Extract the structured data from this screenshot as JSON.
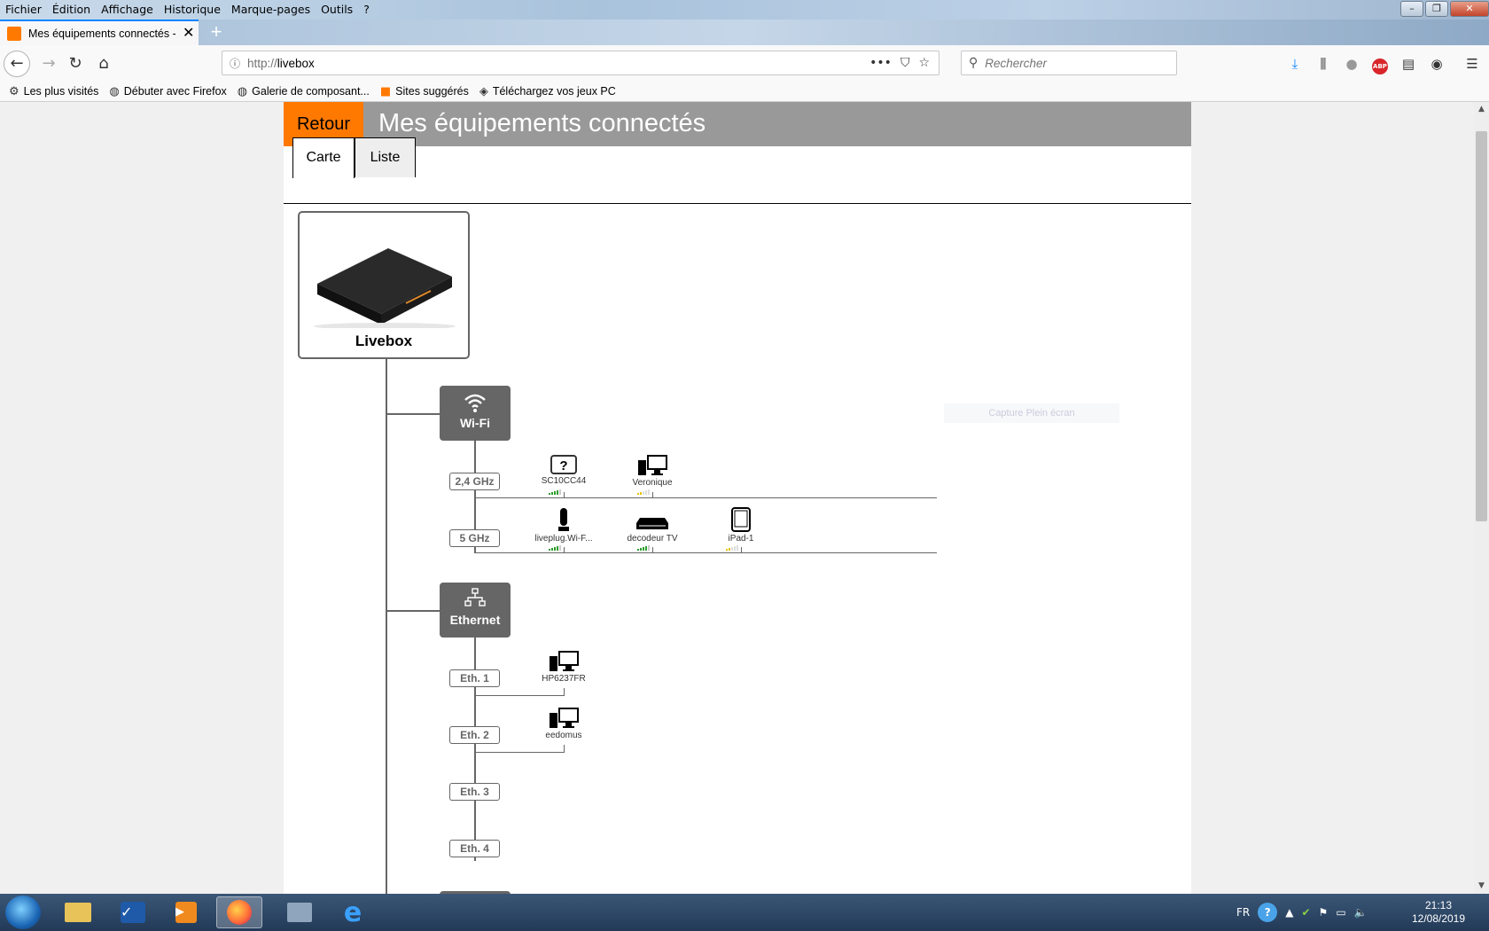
{
  "browser": {
    "menu": [
      "Fichier",
      "Édition",
      "Affichage",
      "Historique",
      "Marque-pages",
      "Outils",
      "?"
    ],
    "tab_title": "Mes équipements connectés - ",
    "url_protocol": "http://",
    "url_host": "livebox",
    "search_placeholder": "Rechercher",
    "bookmarks": [
      "Les plus visités",
      "Débuter avec Firefox",
      "Galerie de composant...",
      "Sites suggérés",
      "Téléchargez vos jeux PC"
    ]
  },
  "page": {
    "back_label": "Retour",
    "title": "Mes équipements connectés",
    "tabs": [
      "Carte",
      "Liste"
    ],
    "active_tab": "Carte",
    "livebox_label": "Livebox",
    "ghost_text": "Capture Plein écran"
  },
  "network": {
    "wifi": {
      "label": "Wi-Fi",
      "bands": [
        {
          "label": "2,4 GHz",
          "devices": [
            {
              "name": "SC10CC44",
              "icon": "unknown-icon",
              "signal_level": 4,
              "signal_color": "#2e9e2e"
            },
            {
              "name": "Veronique",
              "icon": "computer-icon",
              "signal_level": 2,
              "signal_color": "#e6c200"
            }
          ]
        },
        {
          "label": "5 GHz",
          "devices": [
            {
              "name": "liveplug.Wi-F...",
              "icon": "liveplug-icon",
              "signal_level": 4,
              "signal_color": "#2e9e2e"
            },
            {
              "name": "decodeur TV",
              "icon": "decoder-icon",
              "signal_level": 4,
              "signal_color": "#2e9e2e"
            },
            {
              "name": "iPad-1",
              "icon": "tablet-icon",
              "signal_level": 2,
              "signal_color": "#e6c200"
            }
          ]
        }
      ]
    },
    "ethernet": {
      "label": "Ethernet",
      "ports": [
        {
          "label": "Eth. 1",
          "device": "HP6237FR"
        },
        {
          "label": "Eth. 2",
          "device": "eedomus"
        },
        {
          "label": "Eth. 3",
          "device": ""
        },
        {
          "label": "Eth. 4",
          "device": ""
        }
      ]
    }
  },
  "taskbar": {
    "language": "FR",
    "time": "21:13",
    "date": "12/08/2019"
  },
  "colors": {
    "accent_orange": "#ff7900",
    "header_grey": "#999999",
    "node_grey": "#666666"
  }
}
